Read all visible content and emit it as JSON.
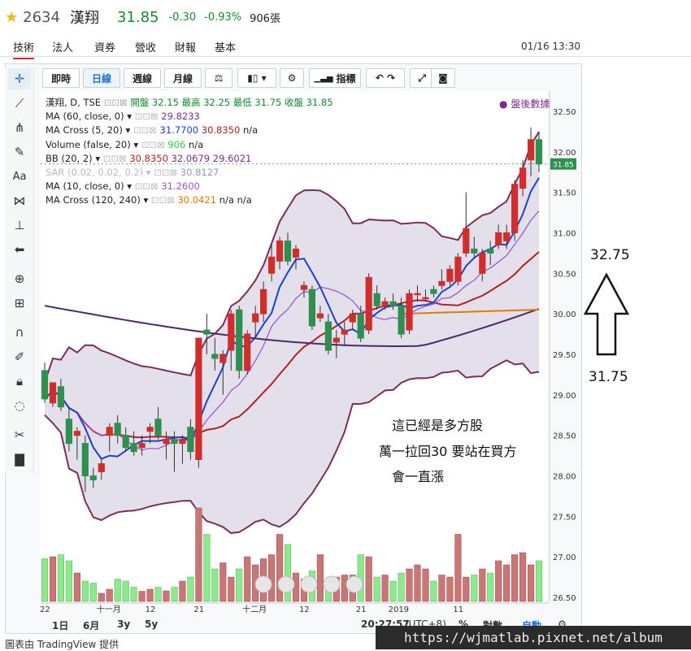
{
  "quote": {
    "code": "2634",
    "name": "漢翔",
    "price": "31.85",
    "change": "-0.30",
    "change_pct": "-0.93%",
    "volume": "906張"
  },
  "tabs": [
    "技術",
    "法人",
    "資券",
    "營收",
    "財報",
    "基本"
  ],
  "active_tab": "技術",
  "datetime": "01/16 13:30",
  "toolbar": {
    "intraday": "即時",
    "daily": "日線",
    "weekly": "週線",
    "monthly": "月線",
    "indicators": "指標",
    "active": "日線"
  },
  "legend": {
    "symbol_line": "漢翔, D, TSE",
    "ohlc": "開盤 32.15 最高 32.25 最低 31.75 收盤 31.85",
    "post_market": "盤後數據",
    "rows": [
      {
        "label": "MA (60, close, 0)",
        "values": [
          "29.8233"
        ],
        "colors": [
          "#7b2d8b"
        ]
      },
      {
        "label": "MA Cross (5, 20)",
        "values": [
          "31.7700",
          "30.8350",
          "n/a"
        ],
        "colors": [
          "#1f3fd1",
          "#b22222",
          "#222222"
        ]
      },
      {
        "label": "Volume (false, 20)",
        "values": [
          "906",
          "n/a"
        ],
        "colors": [
          "#2ecc40",
          "#222222"
        ]
      },
      {
        "label": "BB (20, 2)",
        "values": [
          "30.8350",
          "32.0679",
          "29.6021"
        ],
        "colors": [
          "#b22222",
          "#7b2d8b",
          "#7b2d8b"
        ]
      },
      {
        "label": "SAR (0.02, 0.02, 0.2)",
        "values": [
          "30.8127"
        ],
        "colors": [
          "#999999"
        ]
      },
      {
        "label": "MA (10, close, 0)",
        "values": [
          "31.2600"
        ],
        "colors": [
          "#9b59d0"
        ]
      },
      {
        "label": "MA Cross (120, 240)",
        "values": [
          "30.0421",
          "n/a",
          "n/a"
        ],
        "colors": [
          "#e07b00",
          "#222222",
          "#222222"
        ]
      }
    ]
  },
  "yaxis_labels": [
    "32.50",
    "32.00",
    "31.85",
    "31.50",
    "31.00",
    "30.50",
    "30.00",
    "29.50",
    "29.00",
    "28.50",
    "28.00",
    "27.50",
    "27.00",
    "26.50"
  ],
  "xaxis_labels": [
    "22",
    "十一月",
    "12",
    "21",
    "十二月",
    "12",
    "21",
    "2019",
    "11"
  ],
  "bottom_controls": {
    "ranges": [
      "1日",
      "6月",
      "3y",
      "5y"
    ],
    "time": "20:27:57",
    "tz": "(UTC+8)",
    "pct": "%",
    "log": "對數",
    "auto": "自動"
  },
  "annotation": {
    "line1": "這已經是多方股",
    "line2": "萬一拉回30 要站在買方",
    "line3": "會一直漲",
    "top_value": "32.75",
    "bottom_value": "31.75"
  },
  "footnote": "圖表由 TradingView 提供",
  "watermark": "https://wjmatlab.pixnet.net/album",
  "chart_data": {
    "type": "candlestick",
    "ylim": [
      26.45,
      32.75
    ],
    "candles": [
      {
        "o": 29.3,
        "h": 29.4,
        "l": 28.9,
        "c": 28.95
      },
      {
        "o": 28.9,
        "h": 29.15,
        "l": 28.85,
        "c": 29.15
      },
      {
        "o": 29.1,
        "h": 29.2,
        "l": 28.8,
        "c": 28.85
      },
      {
        "o": 28.7,
        "h": 28.85,
        "l": 28.3,
        "c": 28.4
      },
      {
        "o": 28.5,
        "h": 28.6,
        "l": 28.2,
        "c": 28.55
      },
      {
        "o": 28.4,
        "h": 28.5,
        "l": 27.8,
        "c": 28.0
      },
      {
        "o": 28.0,
        "h": 28.1,
        "l": 27.85,
        "c": 27.95
      },
      {
        "o": 28.05,
        "h": 28.2,
        "l": 27.95,
        "c": 28.15
      },
      {
        "o": 28.5,
        "h": 28.65,
        "l": 28.3,
        "c": 28.6
      },
      {
        "o": 28.65,
        "h": 28.75,
        "l": 28.4,
        "c": 28.5
      },
      {
        "o": 28.5,
        "h": 28.6,
        "l": 28.3,
        "c": 28.35
      },
      {
        "o": 28.4,
        "h": 28.55,
        "l": 28.25,
        "c": 28.3
      },
      {
        "o": 28.35,
        "h": 28.5,
        "l": 28.25,
        "c": 28.4
      },
      {
        "o": 28.55,
        "h": 28.65,
        "l": 28.4,
        "c": 28.6
      },
      {
        "o": 28.7,
        "h": 28.85,
        "l": 28.45,
        "c": 28.5
      },
      {
        "o": 28.4,
        "h": 28.55,
        "l": 28.2,
        "c": 28.45
      },
      {
        "o": 28.45,
        "h": 28.55,
        "l": 28.05,
        "c": 28.4
      },
      {
        "o": 28.4,
        "h": 28.5,
        "l": 28.15,
        "c": 28.45
      },
      {
        "o": 28.6,
        "h": 28.7,
        "l": 28.2,
        "c": 28.3
      },
      {
        "o": 28.2,
        "h": 29.7,
        "l": 28.1,
        "c": 29.7
      },
      {
        "o": 29.8,
        "h": 30.0,
        "l": 29.5,
        "c": 29.75
      },
      {
        "o": 29.5,
        "h": 29.7,
        "l": 29.3,
        "c": 29.45
      },
      {
        "o": 29.4,
        "h": 29.55,
        "l": 29.0,
        "c": 29.5
      },
      {
        "o": 29.55,
        "h": 30.05,
        "l": 29.3,
        "c": 30.0
      },
      {
        "o": 30.05,
        "h": 30.1,
        "l": 29.2,
        "c": 29.3
      },
      {
        "o": 29.3,
        "h": 29.8,
        "l": 29.25,
        "c": 29.75
      },
      {
        "o": 29.9,
        "h": 30.1,
        "l": 29.7,
        "c": 30.0
      },
      {
        "o": 30.0,
        "h": 30.4,
        "l": 29.9,
        "c": 30.3
      },
      {
        "o": 30.5,
        "h": 30.85,
        "l": 30.4,
        "c": 30.7
      },
      {
        "o": 30.65,
        "h": 30.95,
        "l": 30.55,
        "c": 30.9
      },
      {
        "o": 30.9,
        "h": 31.0,
        "l": 30.6,
        "c": 30.65
      },
      {
        "o": 30.7,
        "h": 30.85,
        "l": 30.55,
        "c": 30.8
      },
      {
        "o": 30.3,
        "h": 30.4,
        "l": 30.2,
        "c": 30.35
      },
      {
        "o": 30.3,
        "h": 30.35,
        "l": 29.8,
        "c": 29.85
      },
      {
        "o": 29.95,
        "h": 30.1,
        "l": 29.9,
        "c": 30.0
      },
      {
        "o": 29.9,
        "h": 30.0,
        "l": 29.5,
        "c": 29.55
      },
      {
        "o": 29.65,
        "h": 29.8,
        "l": 29.45,
        "c": 29.7
      },
      {
        "o": 29.75,
        "h": 29.9,
        "l": 29.6,
        "c": 29.8
      },
      {
        "o": 29.9,
        "h": 30.05,
        "l": 29.8,
        "c": 30.0
      },
      {
        "o": 30.0,
        "h": 30.1,
        "l": 29.65,
        "c": 29.7
      },
      {
        "o": 29.8,
        "h": 30.5,
        "l": 29.75,
        "c": 30.45
      },
      {
        "o": 30.25,
        "h": 30.35,
        "l": 30.05,
        "c": 30.1
      },
      {
        "o": 30.1,
        "h": 30.2,
        "l": 30.05,
        "c": 30.15
      },
      {
        "o": 30.15,
        "h": 30.25,
        "l": 30.05,
        "c": 30.1
      },
      {
        "o": 30.1,
        "h": 30.2,
        "l": 29.7,
        "c": 29.75
      },
      {
        "o": 29.8,
        "h": 30.3,
        "l": 29.75,
        "c": 30.25
      },
      {
        "o": 30.25,
        "h": 30.35,
        "l": 30.15,
        "c": 30.25
      },
      {
        "o": 30.2,
        "h": 30.3,
        "l": 30.15,
        "c": 30.2
      },
      {
        "o": 30.3,
        "h": 30.35,
        "l": 30.2,
        "c": 30.25
      },
      {
        "o": 30.35,
        "h": 30.55,
        "l": 30.3,
        "c": 30.4
      },
      {
        "o": 30.4,
        "h": 30.6,
        "l": 30.35,
        "c": 30.55
      },
      {
        "o": 30.4,
        "h": 30.75,
        "l": 30.35,
        "c": 30.7
      },
      {
        "o": 30.75,
        "h": 31.5,
        "l": 30.7,
        "c": 31.05
      },
      {
        "o": 30.8,
        "h": 30.95,
        "l": 30.7,
        "c": 30.75
      },
      {
        "o": 30.5,
        "h": 30.8,
        "l": 30.4,
        "c": 30.75
      },
      {
        "o": 30.8,
        "h": 30.9,
        "l": 30.6,
        "c": 30.75
      },
      {
        "o": 30.85,
        "h": 31.1,
        "l": 30.8,
        "c": 31.0
      },
      {
        "o": 30.9,
        "h": 31.1,
        "l": 30.8,
        "c": 31.0
      },
      {
        "o": 31.0,
        "h": 31.65,
        "l": 30.9,
        "c": 31.6
      },
      {
        "o": 31.55,
        "h": 31.9,
        "l": 31.45,
        "c": 31.8
      },
      {
        "o": 31.9,
        "h": 32.3,
        "l": 31.7,
        "c": 32.15
      },
      {
        "o": 32.15,
        "h": 32.25,
        "l": 31.75,
        "c": 31.85
      }
    ],
    "volume": [
      1050,
      1100,
      1150,
      1000,
      700,
      500,
      450,
      200,
      300,
      550,
      500,
      350,
      250,
      300,
      350,
      260,
      350,
      500,
      600,
      2300,
      1650,
      800,
      950,
      600,
      800,
      1100,
      900,
      1050,
      1150,
      1650,
      1400,
      700,
      550,
      750,
      1150,
      500,
      600,
      650,
      650,
      1150,
      1100,
      600,
      650,
      500,
      700,
      800,
      900,
      800,
      500,
      650,
      600,
      1650,
      600,
      650,
      800,
      700,
      1000,
      900,
      1150,
      1200,
      900,
      1000
    ]
  }
}
